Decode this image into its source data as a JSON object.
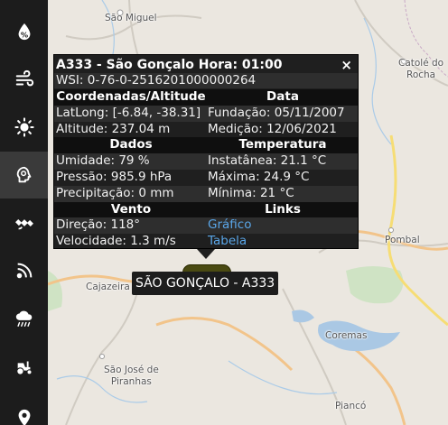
{
  "sidebar": {
    "items": [
      {
        "name": "humidity-icon"
      },
      {
        "name": "wind-icon"
      },
      {
        "name": "sun-icon"
      },
      {
        "name": "brain-icon",
        "active": true
      },
      {
        "name": "satellite-icon"
      },
      {
        "name": "signal-icon"
      },
      {
        "name": "rain-icon"
      },
      {
        "name": "tractor-icon"
      },
      {
        "name": "location-icon"
      }
    ]
  },
  "map": {
    "places": {
      "sao_miguel": "São Miguel",
      "catole_line1": "Catolé do",
      "catole_line2": "Rocha",
      "pombal": "Pombal",
      "cajazeiras": "Cajazeira",
      "coremas": "Coremas",
      "sao_jose_line1": "São José de",
      "sao_jose_line2": "Piranhas",
      "pianco": "Piancó"
    }
  },
  "popup": {
    "title": "A333 - São Gonçalo Hora: 01:00",
    "close_label": "×",
    "wsi": "WSI: 0-76-0-2516201000000264",
    "headers": {
      "coords": "Coordenadas/Altitude",
      "data": "Data",
      "dados": "Dados",
      "temperatura": "Temperatura",
      "vento": "Vento",
      "links": "Links"
    },
    "latlong": "LatLong: [-6.84, -38.31]",
    "fundacao": "Fundação: 05/11/2007",
    "altitude": "Altitude: 237.04 m",
    "medicao": "Medição: 12/06/2021",
    "umidade": "Umidade: 79 %",
    "instantanea": "Instatânea: 21.1 °C",
    "pressao": "Pressão: 985.9 hPa",
    "maxima": "Máxima: 24.9 °C",
    "precipitacao": "Precipitação: 0 mm",
    "minima": "Mínima: 21 °C",
    "direcao": "Direção: 118°",
    "grafico": "Gráfico",
    "velocidade": "Velocidade: 1.3 m/s",
    "tabela": "Tabela"
  },
  "station_label": "SÃO GONÇALO - A333"
}
